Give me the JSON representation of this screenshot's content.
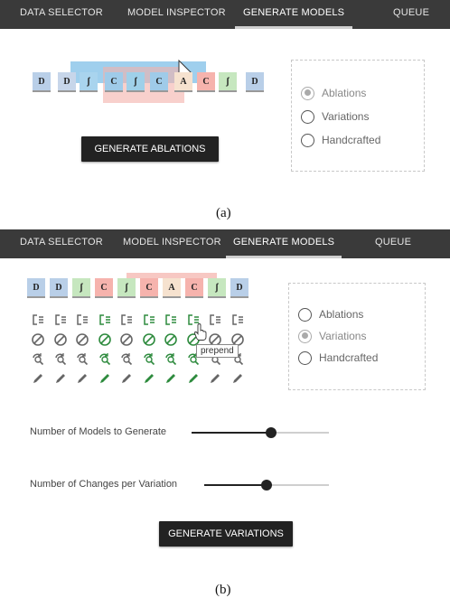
{
  "panel_a": {
    "nav": {
      "tabs": [
        {
          "label": "DATA SELECTOR"
        },
        {
          "label": "MODEL INSPECTOR"
        },
        {
          "label": "GENERATE MODELS"
        },
        {
          "label": "QUEUE"
        }
      ],
      "active_tab": "GENERATE MODELS"
    },
    "blocks": [
      {
        "label": "D",
        "color": "#b9cfe8"
      },
      {
        "label": "D",
        "color": "#c7d6ea"
      },
      {
        "label": "ʃ",
        "color": "#a9d4ee"
      },
      {
        "label": "C",
        "color": "#9fcbe9"
      },
      {
        "label": "ʃ",
        "color": "#9fd0e9"
      },
      {
        "label": "C",
        "color": "#9fcbe9"
      },
      {
        "label": "A",
        "color": "#f6e2cf"
      },
      {
        "label": "C",
        "color": "#f6b3ad"
      },
      {
        "label": "ʃ",
        "color": "#c6e7bf"
      },
      {
        "label": "D",
        "color": "#b9cfe8"
      }
    ],
    "options": [
      {
        "label": "Ablations",
        "checked": true
      },
      {
        "label": "Variations",
        "checked": false
      },
      {
        "label": "Handcrafted",
        "checked": false
      }
    ],
    "button_label": "GENERATE ABLATIONS",
    "caption": "(a)"
  },
  "panel_b": {
    "nav": {
      "tabs": [
        {
          "label": "DATA SELECTOR"
        },
        {
          "label": "MODEL INSPECTOR"
        },
        {
          "label": "GENERATE MODELS"
        },
        {
          "label": "QUEUE"
        }
      ],
      "active_tab": "GENERATE MODELS"
    },
    "blocks": [
      {
        "label": "D",
        "color": "#b9cfe8"
      },
      {
        "label": "D",
        "color": "#b9cfe8"
      },
      {
        "label": "ʃ",
        "color": "#c6e7bf"
      },
      {
        "label": "C",
        "color": "#f6b3ad"
      },
      {
        "label": "ʃ",
        "color": "#c6e7bf"
      },
      {
        "label": "C",
        "color": "#f6b3ad"
      },
      {
        "label": "A",
        "color": "#f6e2cf"
      },
      {
        "label": "C",
        "color": "#f6b3ad"
      },
      {
        "label": "ʃ",
        "color": "#c6e7bf"
      },
      {
        "label": "D",
        "color": "#b9cfe8"
      }
    ],
    "edit_icons": {
      "rows": [
        "prepend-icon",
        "disable-icon",
        "replace-icon",
        "edit-icon"
      ],
      "highlighted_columns": [
        3,
        5,
        6,
        7
      ],
      "highlight_color": "#2e8b3e"
    },
    "tooltip": "prepend",
    "options": [
      {
        "label": "Ablations",
        "checked": false
      },
      {
        "label": "Variations",
        "checked": true
      },
      {
        "label": "Handcrafted",
        "checked": false
      }
    ],
    "sliders": [
      {
        "label": "Number of Models to Generate",
        "value": 0.58
      },
      {
        "label": "Number of Changes per Variation",
        "value": 0.5
      }
    ],
    "button_label": "GENERATE VARIATIONS",
    "caption": "(b)"
  }
}
